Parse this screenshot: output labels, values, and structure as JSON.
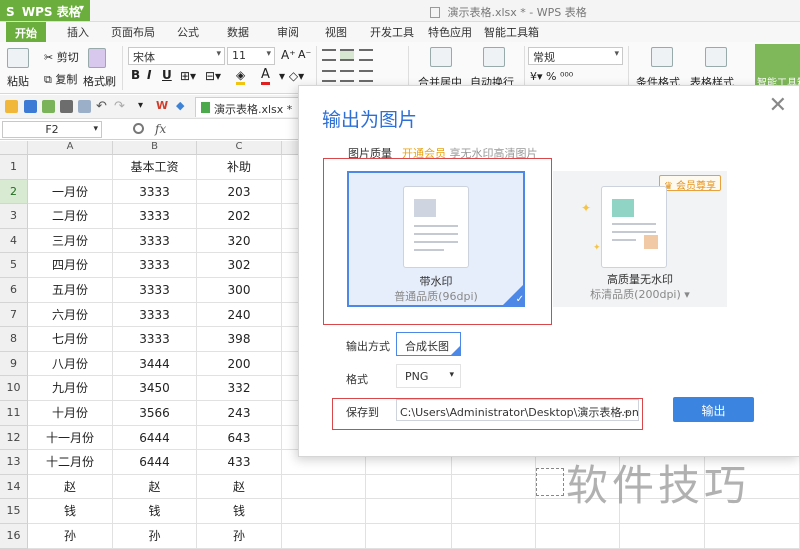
{
  "titlebar": {
    "app_name": "WPS 表格",
    "app_logo": "S",
    "doc_title": "演示表格.xlsx * - WPS 表格"
  },
  "menu": [
    "开始",
    "插入",
    "页面布局",
    "公式",
    "数据",
    "审阅",
    "视图",
    "开发工具",
    "特色应用",
    "智能工具箱"
  ],
  "ribbon": {
    "paste": "粘贴",
    "cut": "剪切",
    "copy": "复制",
    "format_painter": "格式刷",
    "font": "宋体",
    "font_size": "11",
    "number_format": "常规",
    "merge": "合并居中",
    "wrap": "自动换行",
    "conditional": "条件格式",
    "table_style": "表格样式",
    "smart_toolbox": "智能工具箱",
    "bold": "B",
    "italic": "I",
    "underline": "U"
  },
  "qat": {
    "doc_tab": "演示表格.xlsx *"
  },
  "formula_bar": {
    "cell_ref": "F2",
    "fx": "fx"
  },
  "sheet": {
    "columns": [
      "A",
      "B",
      "C"
    ],
    "headers": [
      "",
      "基本工资",
      "补助"
    ],
    "rows": [
      [
        "一月份",
        "3333",
        "203"
      ],
      [
        "二月份",
        "3333",
        "202"
      ],
      [
        "三月份",
        "3333",
        "320"
      ],
      [
        "四月份",
        "3333",
        "302"
      ],
      [
        "五月份",
        "3333",
        "300"
      ],
      [
        "六月份",
        "3333",
        "240"
      ],
      [
        "七月份",
        "3333",
        "398"
      ],
      [
        "八月份",
        "3444",
        "200"
      ],
      [
        "九月份",
        "3450",
        "332"
      ],
      [
        "十月份",
        "3566",
        "243"
      ],
      [
        "十一月份",
        "6444",
        "643"
      ],
      [
        "十二月份",
        "6444",
        "433"
      ],
      [
        "赵",
        "赵",
        "赵"
      ],
      [
        "钱",
        "钱",
        "钱"
      ],
      [
        "孙",
        "孙",
        "孙"
      ]
    ]
  },
  "dialog": {
    "title": "输出为图片",
    "quality_label": "图片质量",
    "promo_link": "开通会员",
    "promo_text": "享无水印高清图片",
    "card1_title": "带水印",
    "card1_sub": "普通品质(96dpi)",
    "card2_title": "高质量无水印",
    "card2_sub": "标清品质(200dpi)",
    "vip_badge": "会员尊享",
    "output_mode_label": "输出方式",
    "output_mode_value": "合成长图",
    "format_label": "格式",
    "format_value": "PNG",
    "save_label": "保存到",
    "save_path": "C:\\Users\\Administrator\\Desktop\\演示表格.png",
    "browse": "...",
    "export_button": "输出"
  },
  "watermark": "软件技巧",
  "colors": {
    "wps_green": "#6cae3d",
    "dialog_blue": "#3b85e0",
    "highlight_red": "#d9474a"
  }
}
